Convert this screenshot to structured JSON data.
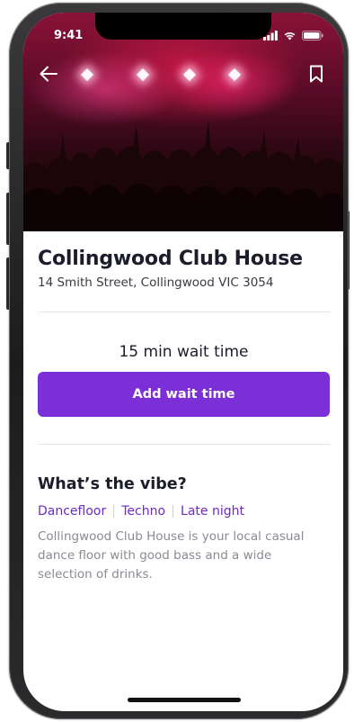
{
  "status_bar": {
    "time": "9:41"
  },
  "navigation": {
    "back_icon": "arrow-left-icon",
    "bookmark_icon": "bookmark-icon"
  },
  "venue": {
    "name": "Collingwood Club House",
    "address": "14 Smith Street, Collingwood VIC 3054"
  },
  "wait": {
    "text": "15 min wait time",
    "button_label": "Add wait time"
  },
  "vibe": {
    "heading": "What’s the vibe?",
    "tags": [
      "Dancefloor",
      "Techno",
      "Late night"
    ],
    "description": "Collingwood Club House is your local casual dance floor with good bass and a wide selection of drinks."
  },
  "colors": {
    "accent": "#7b2fd6",
    "tag_text": "#6e2cc2",
    "title_text": "#1c1d2b",
    "muted_text": "#8a8a94"
  }
}
